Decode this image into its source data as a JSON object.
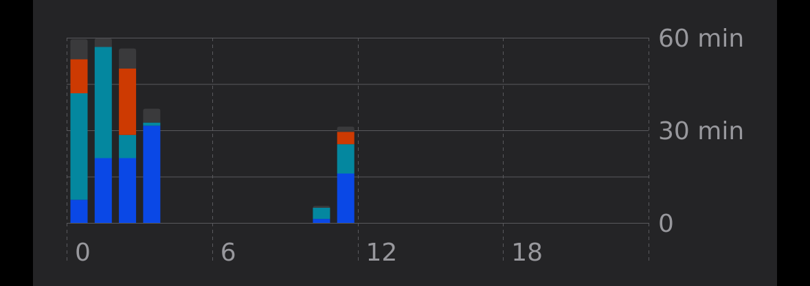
{
  "chart_data": {
    "type": "bar",
    "stacked": true,
    "x_ticks": [
      "0",
      "6",
      "12",
      "18"
    ],
    "y_ticks": [
      "60 min",
      "30 min",
      "0"
    ],
    "ylim": [
      0,
      60
    ],
    "grid": true,
    "colors": {
      "background": "#242426",
      "page": "#000000",
      "grid": "#5a5a5e",
      "tick_text": "#98989d"
    },
    "series": [
      {
        "color": "#0a48e6",
        "values": [
          {
            "hour": 0,
            "value": 7.5
          },
          {
            "hour": 1,
            "value": 21
          },
          {
            "hour": 2,
            "value": 21
          },
          {
            "hour": 3,
            "value": 31.5
          },
          {
            "hour": 10,
            "value": 1.3
          },
          {
            "hour": 11,
            "value": 16
          }
        ]
      },
      {
        "color": "#04879f",
        "values": [
          {
            "hour": 0,
            "value": 34.5
          },
          {
            "hour": 1,
            "value": 36
          },
          {
            "hour": 2,
            "value": 7.5
          },
          {
            "hour": 3,
            "value": 1
          },
          {
            "hour": 10,
            "value": 3.6
          },
          {
            "hour": 11,
            "value": 9.5
          }
        ]
      },
      {
        "color": "#cd3a02",
        "values": [
          {
            "hour": 0,
            "value": 11
          },
          {
            "hour": 2,
            "value": 21.5
          },
          {
            "hour": 11,
            "value": 4
          }
        ]
      },
      {
        "color": "#3a3a3c",
        "values": [
          {
            "hour": 0,
            "value": 6.5
          },
          {
            "hour": 1,
            "value": 2.8
          },
          {
            "hour": 2,
            "value": 6.5
          },
          {
            "hour": 3,
            "value": 4.5
          },
          {
            "hour": 10,
            "value": 0.6
          },
          {
            "hour": 11,
            "value": 1.7
          }
        ]
      }
    ]
  }
}
